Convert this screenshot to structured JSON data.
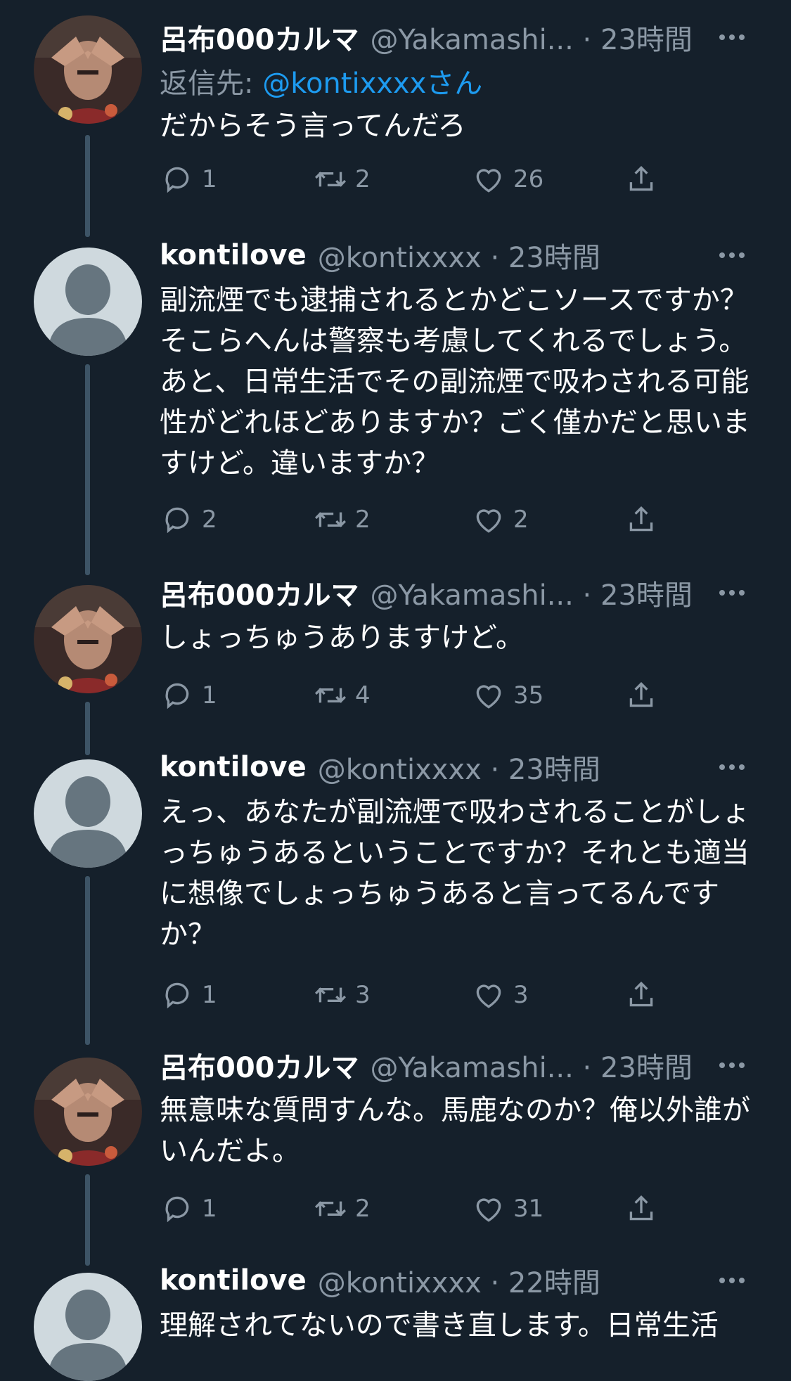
{
  "colors": {
    "background": "#15202b",
    "text": "#ffffff",
    "secondary": "#8b98a5",
    "link": "#1d9bf0",
    "thread_line": "#3d5466"
  },
  "tweets": [
    {
      "name": "呂布000カルマ",
      "handle": "@Yakamashi...",
      "time": "23時間",
      "reply_to_prefix": "返信先: ",
      "reply_to_mention": "@kontixxxxさん",
      "text": "だからそう言ってんだろ",
      "replies": "1",
      "retweets": "2",
      "likes": "26"
    },
    {
      "name": "kontilove",
      "handle": "@kontixxxx",
      "time": "23時間",
      "text": "副流煙でも逮捕されるとかどこソースですか？そこらへんは警察も考慮してくれるでしょう。あと、日常生活でその副流煙で吸わされる可能性がどれほどありますか？ごく僅かだと思いますけど。違いますか？",
      "replies": "2",
      "retweets": "2",
      "likes": "2"
    },
    {
      "name": "呂布000カルマ",
      "handle": "@Yakamashi...",
      "time": "23時間",
      "text": "しょっちゅうありますけど。",
      "replies": "1",
      "retweets": "4",
      "likes": "35"
    },
    {
      "name": "kontilove",
      "handle": "@kontixxxx",
      "time": "23時間",
      "text": "えっ、あなたが副流煙で吸わされることがしょっちゅうあるということですか？それとも適当に想像でしょっちゅうあると言ってるんですか？",
      "replies": "1",
      "retweets": "3",
      "likes": "3"
    },
    {
      "name": "呂布000カルマ",
      "handle": "@Yakamashi...",
      "time": "23時間",
      "text": "無意味な質問すんな。馬鹿なのか？俺以外誰がいんだよ。",
      "replies": "1",
      "retweets": "2",
      "likes": "31"
    },
    {
      "name": "kontilove",
      "handle": "@kontixxxx",
      "time": "22時間",
      "text": "理解されてないので書き直します。日常生活"
    }
  ],
  "icons": {
    "reply": "reply-icon",
    "retweet": "retweet-icon",
    "like": "heart-icon",
    "share": "share-icon",
    "more": "more-icon"
  }
}
